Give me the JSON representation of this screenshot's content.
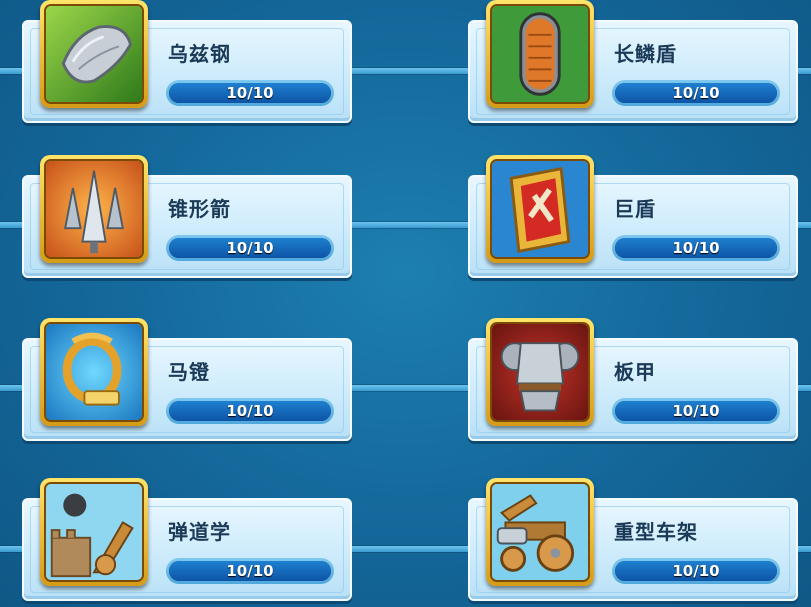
{
  "items": [
    {
      "name": "乌兹钢",
      "progress": "10/10",
      "level": 1.0,
      "icon": "wootz-steel-icon"
    },
    {
      "name": "长鳞盾",
      "progress": "10/10",
      "level": 1.0,
      "icon": "scale-shield-icon"
    },
    {
      "name": "锥形箭",
      "progress": "10/10",
      "level": 1.0,
      "icon": "bodkin-arrow-icon"
    },
    {
      "name": "巨盾",
      "progress": "10/10",
      "level": 1.0,
      "icon": "pavise-icon"
    },
    {
      "name": "马镫",
      "progress": "10/10",
      "level": 1.0,
      "icon": "stirrup-icon"
    },
    {
      "name": "板甲",
      "progress": "10/10",
      "level": 1.0,
      "icon": "plate-armor-icon"
    },
    {
      "name": "弹道学",
      "progress": "10/10",
      "level": 1.0,
      "icon": "ballistics-icon"
    },
    {
      "name": "重型车架",
      "progress": "10/10",
      "level": 1.0,
      "icon": "heavy-chassis-icon"
    }
  ]
}
